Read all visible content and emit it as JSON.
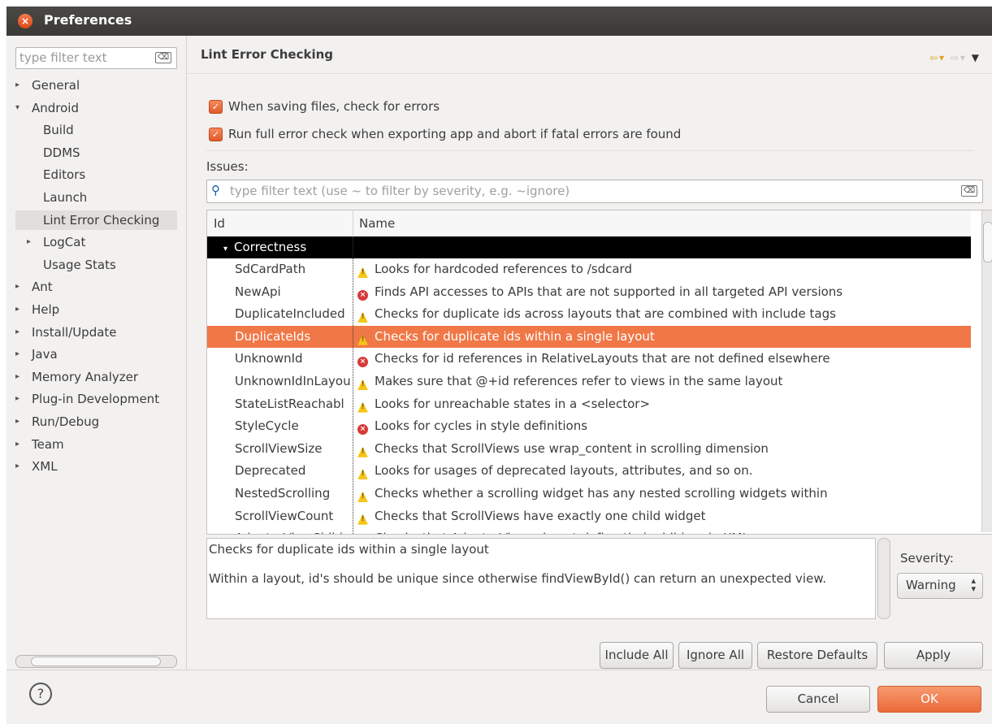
{
  "window": {
    "title": "Preferences",
    "close_glyph": "×"
  },
  "left": {
    "filter_placeholder": "type filter text",
    "clear_glyph": "⌫",
    "tree": [
      {
        "label": "General",
        "level": 0,
        "arrow": "▸"
      },
      {
        "label": "Android",
        "level": 0,
        "arrow": "▾"
      },
      {
        "label": "Build",
        "level": 1,
        "arrow": ""
      },
      {
        "label": "DDMS",
        "level": 1,
        "arrow": ""
      },
      {
        "label": "Editors",
        "level": 1,
        "arrow": ""
      },
      {
        "label": "Launch",
        "level": 1,
        "arrow": ""
      },
      {
        "label": "Lint Error Checking",
        "level": 1,
        "arrow": "",
        "selected": true
      },
      {
        "label": "LogCat",
        "level": 1,
        "arrow": "▸"
      },
      {
        "label": "Usage Stats",
        "level": 1,
        "arrow": ""
      },
      {
        "label": "Ant",
        "level": 0,
        "arrow": "▸"
      },
      {
        "label": "Help",
        "level": 0,
        "arrow": "▸"
      },
      {
        "label": "Install/Update",
        "level": 0,
        "arrow": "▸"
      },
      {
        "label": "Java",
        "level": 0,
        "arrow": "▸"
      },
      {
        "label": "Memory Analyzer",
        "level": 0,
        "arrow": "▸"
      },
      {
        "label": "Plug-in Development",
        "level": 0,
        "arrow": "▸"
      },
      {
        "label": "Run/Debug",
        "level": 0,
        "arrow": "▸"
      },
      {
        "label": "Team",
        "level": 0,
        "arrow": "▸"
      },
      {
        "label": "XML",
        "level": 0,
        "arrow": "▸"
      }
    ]
  },
  "page": {
    "title": "Lint Error Checking",
    "nav": {
      "back": "⇦▾",
      "forward": "⇨▾",
      "menu": "▼"
    },
    "checkboxes": [
      {
        "label": "When saving files, check for errors",
        "checked": true
      },
      {
        "label": "Run full error check when exporting app and abort if fatal errors are found",
        "checked": true
      }
    ],
    "check_glyph": "✓",
    "issues_label": "Issues:",
    "search_glyph": "🔍",
    "search_placeholder": "type filter text (use ~ to filter by severity, e.g. ~ignore)",
    "table": {
      "columns": [
        "Id",
        "Name"
      ],
      "category": "Correctness",
      "category_arrow": "▾",
      "rows": [
        {
          "id": "SdCardPath",
          "severity": "warning",
          "name": "Looks for hardcoded references to /sdcard"
        },
        {
          "id": "NewApi",
          "severity": "error",
          "name": "Finds API accesses to APIs that are not supported in all targeted API versions"
        },
        {
          "id": "DuplicateIncluded",
          "severity": "warning",
          "name": "Checks for duplicate ids across layouts that are combined with include tags"
        },
        {
          "id": "DuplicateIds",
          "severity": "warning",
          "name": "Checks for duplicate ids within a single layout",
          "selected": true
        },
        {
          "id": "UnknownId",
          "severity": "error",
          "name": "Checks for id references in RelativeLayouts that are not defined elsewhere"
        },
        {
          "id": "UnknownIdInLayou",
          "severity": "warning",
          "name": "Makes sure that @+id references refer to views in the same layout"
        },
        {
          "id": "StateListReachabl",
          "severity": "warning",
          "name": "Looks for unreachable states in a <selector>"
        },
        {
          "id": "StyleCycle",
          "severity": "error",
          "name": "Looks for cycles in style definitions"
        },
        {
          "id": "ScrollViewSize",
          "severity": "warning",
          "name": "Checks that ScrollViews use wrap_content in scrolling dimension"
        },
        {
          "id": "Deprecated",
          "severity": "warning",
          "name": "Looks for usages of deprecated layouts, attributes, and so on."
        },
        {
          "id": "NestedScrolling",
          "severity": "warning",
          "name": "Checks whether a scrolling widget has any nested scrolling widgets within"
        },
        {
          "id": "ScrollViewCount",
          "severity": "warning",
          "name": "Checks that ScrollViews have exactly one child widget"
        },
        {
          "id": "AdapterViewChild",
          "severity": "warning",
          "name": "Checks that AdapterViews do not define their children in XML"
        }
      ]
    },
    "description": {
      "summary": "Checks for duplicate ids within a single layout",
      "detail": "Within a layout, id's should be unique since otherwise findViewById() can return an unexpected view."
    },
    "severity": {
      "label": "Severity:",
      "value": "Warning"
    },
    "buttons": {
      "include_all": "Include All",
      "ignore_all": "Ignore All",
      "restore_defaults": "Restore Defaults",
      "apply": "Apply"
    }
  },
  "footer": {
    "help_glyph": "?",
    "cancel": "Cancel",
    "ok": "OK"
  },
  "colors": {
    "accent": "#f07746",
    "titlebar": "#3c3b37",
    "error": "#d83a3a",
    "warning": "#f5c518"
  }
}
